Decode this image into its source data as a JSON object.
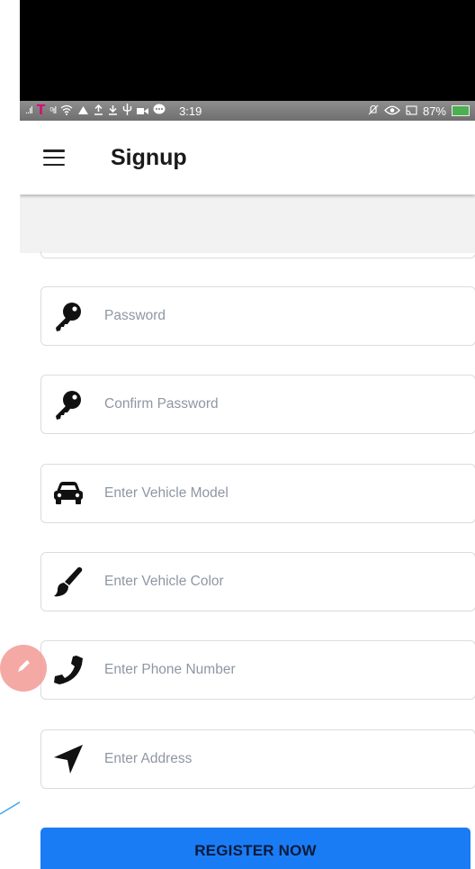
{
  "status_bar": {
    "time": "3:19",
    "battery": "87%",
    "icons": [
      "signal-icon",
      "t-mobile-icon",
      "wifi-icon",
      "notification-icon",
      "upload-icon",
      "download-icon",
      "usb-icon",
      "video-icon",
      "chat-icon",
      "mute-icon",
      "eye-icon",
      "cast-icon",
      "battery-icon"
    ]
  },
  "app_bar": {
    "title": "Signup",
    "menu_icon": "hamburger-menu-icon"
  },
  "fields": [
    {
      "icon": "key-icon",
      "placeholder": "Password"
    },
    {
      "icon": "key-icon",
      "placeholder": "Confirm Password"
    },
    {
      "icon": "car-icon",
      "placeholder": "Enter Vehicle Model"
    },
    {
      "icon": "paintbrush-icon",
      "placeholder": "Enter Vehicle Color"
    },
    {
      "icon": "phone-icon",
      "placeholder": "Enter Phone Number"
    },
    {
      "icon": "location-arrow-icon",
      "placeholder": "Enter Address"
    }
  ],
  "register_button": {
    "label": "REGISTER NOW"
  },
  "colors": {
    "primary": "#1a7cf5",
    "fab": "#f3a09c",
    "backdrop": "#3aa8e8"
  }
}
